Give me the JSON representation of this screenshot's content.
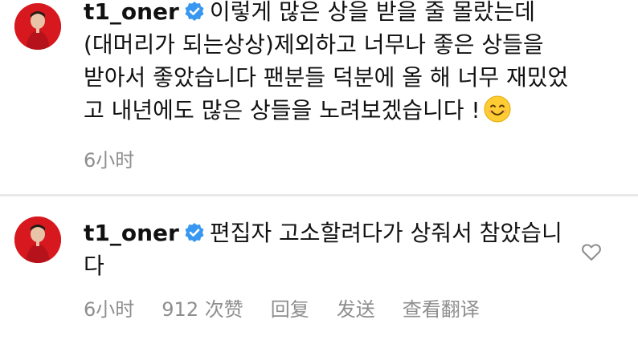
{
  "comments": [
    {
      "username": "t1_oner",
      "text": "이렇게 많은 상을 받을 줄 몰랐는데 (대머리가 되는상상)제외하고 너무나 좋은 상들을 받아서 좋았습니다 팬분들 덕분에 올 해 너무 재밌었고 내년에도 많은 상들을 노려보겠습니다 !",
      "emoji": "smiling-face-icon",
      "time": "6小时"
    },
    {
      "username": "t1_oner",
      "text": "편집자 고소할려다가 상줘서 참았습니다",
      "time": "6小时",
      "likes": "912 次赞",
      "reply": "回复",
      "send": "发送",
      "translate": "查看翻译"
    }
  ],
  "colors": {
    "verified": "#3897f0",
    "meta": "#8e8e8e",
    "avatar_bg": "#d7191f"
  }
}
